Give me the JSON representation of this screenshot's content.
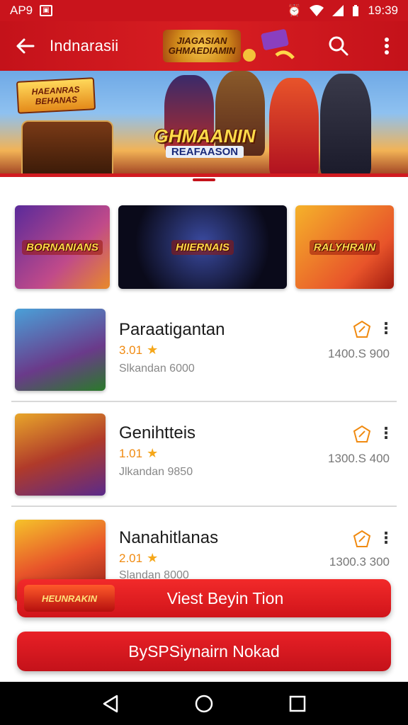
{
  "status_bar": {
    "left_text": "AP9",
    "time": "19:39"
  },
  "app_bar": {
    "title": "Indnarasii",
    "logo_text": "JIAGASIAN GHMAEDIAMIN"
  },
  "hero": {
    "tag_text": "HAEANRAS BEHANAS",
    "title": "GHMAANIN",
    "subtitle": "REAFAASON"
  },
  "featured": [
    {
      "label": "BORNANIANS"
    },
    {
      "label": "HIIERNAIS"
    },
    {
      "label": "RALYHRAIN"
    }
  ],
  "games": [
    {
      "name": "Paraatigantan",
      "rating": "3.01",
      "subtitle": "Slkandan 6000",
      "size": "1400.S 900"
    },
    {
      "name": "Genihtteis",
      "rating": "1.01",
      "subtitle": "Jlkandan 9850",
      "size": "1300.S 400"
    },
    {
      "name": "Nanahitlanas",
      "rating": "2.01",
      "subtitle": "Slandan 8000",
      "size": "1300.3 300"
    }
  ],
  "buttons": {
    "primary_label": "Viest Beyin Tion",
    "primary_badge": "HEUNRAKIN",
    "secondary_label": "BySPSiynairn Nokad"
  },
  "colors": {
    "brand_red": "#c9141c",
    "accent_orange": "#f08a10"
  },
  "icons": {
    "back": "arrow-left-icon",
    "search": "search-icon",
    "more": "more-vertical-icon",
    "tag": "tag-icon"
  }
}
